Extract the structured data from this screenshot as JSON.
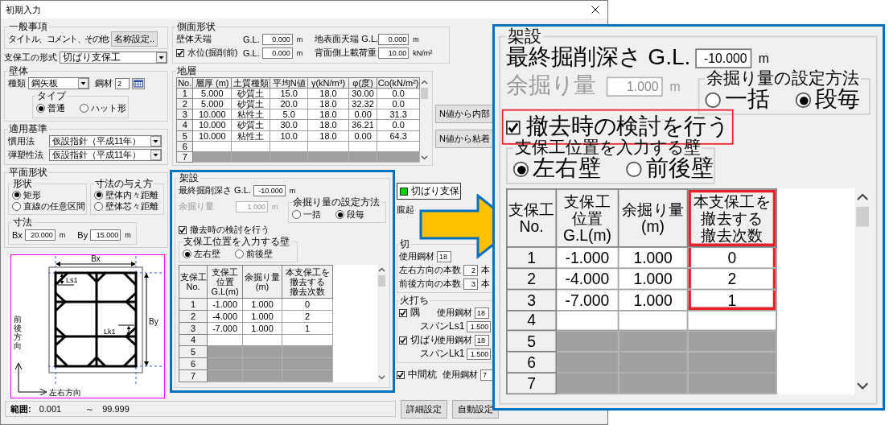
{
  "window": {
    "title": "初期入力"
  },
  "general": {
    "legend": "一般事項",
    "label": "タイトル、コメント、その他:",
    "button": "名称設定.."
  },
  "support_type": {
    "label": "支保工の形式",
    "value": "切ばり支保工"
  },
  "wall": {
    "legend": "壁体",
    "kind_label": "種類",
    "kind_value": "鋼矢板",
    "steel_label": "鋼材",
    "steel_value": "2",
    "type_legend": "タイプ",
    "types": [
      {
        "label": "普通",
        "selected": true
      },
      {
        "label": "ハット形",
        "selected": false
      }
    ]
  },
  "standards": {
    "legend": "適用基準",
    "rows": [
      {
        "label": "慣用法",
        "value": "仮設指針（平成11年）"
      },
      {
        "label": "弾塑性法",
        "value": "仮設指針（平成11年）"
      }
    ]
  },
  "plan_shape": {
    "legend": "平面形状",
    "shape_legend": "形状",
    "shapes": [
      {
        "label": "矩形",
        "selected": true
      },
      {
        "label": "直線の任意区間",
        "selected": false
      }
    ],
    "method_legend": "寸法の与え方",
    "methods": [
      {
        "label": "壁体内々距離",
        "selected": true
      },
      {
        "label": "壁体芯々距離",
        "selected": false
      }
    ],
    "dims_legend": "寸法",
    "bx_label": "Bx",
    "bx_value": "20.000",
    "bx_unit": "m",
    "by_label": "By",
    "by_value": "15.000",
    "by_unit": "m"
  },
  "plan_diagram": {
    "bx": "Bx",
    "by": "By",
    "ls1": "Ls1",
    "lk1": "Lk1",
    "front_back": "前後方向",
    "left_right": "左右方向"
  },
  "side_shape": {
    "legend": "側面形状",
    "wall_top": {
      "label": "壁体天端",
      "gl": "G.L.",
      "value": "0.000",
      "unit": "m"
    },
    "ground_top": {
      "label": "地表面天端 G.L.",
      "value": "0.000",
      "unit": "m"
    },
    "water": {
      "label": "水位(掘削前)",
      "checked": true,
      "gl": "G.L.",
      "value": "0.000",
      "unit": "m"
    },
    "surcharge": {
      "label": "背面側上載荷重",
      "value": "10.00",
      "unit": "kN/m²"
    }
  },
  "strata": {
    "legend": "地層",
    "columns": [
      "No.",
      "層厚 (m)",
      "土質種類",
      "平均N値",
      "γ(kN/m³)",
      "φ(度)",
      "Co(kN/m²)"
    ],
    "rows": [
      {
        "cells": [
          "1",
          "5.000",
          "砂質土",
          "15.0",
          "18.0",
          "30.00",
          "0.0"
        ],
        "disabled": false
      },
      {
        "cells": [
          "2",
          "5.000",
          "砂質土",
          "20.0",
          "18.0",
          "32.32",
          "0.0"
        ],
        "disabled": false
      },
      {
        "cells": [
          "3",
          "10.000",
          "粘性土",
          "5.0",
          "18.0",
          "0.00",
          "31.3"
        ],
        "disabled": false
      },
      {
        "cells": [
          "4",
          "10.000",
          "砂質土",
          "30.0",
          "18.0",
          "36.21",
          "0.0"
        ],
        "disabled": false
      },
      {
        "cells": [
          "5",
          "10.000",
          "粘性土",
          "10.0",
          "18.0",
          "0.00",
          "64.3"
        ],
        "disabled": false
      },
      {
        "cells": [
          "6"
        ],
        "disabled": false
      },
      {
        "cells": [
          "7"
        ],
        "disabled": true
      }
    ]
  },
  "strata_buttons": [
    "N値から内部",
    "N値から粘着"
  ],
  "construction": {
    "legend": "架設",
    "depth": {
      "label": "最終掘削深さ G.L.",
      "value": "-10.000",
      "unit": "m"
    },
    "overdig": {
      "label": "余掘り量",
      "value": "1.000",
      "unit": "m",
      "disabled": true
    },
    "method": {
      "legend": "余掘り量の設定方法",
      "options": [
        {
          "label": "一括",
          "selected": false
        },
        {
          "label": "段毎",
          "selected": true
        }
      ]
    },
    "removal_check": {
      "label": "撤去時の検討を行う",
      "checked": true,
      "highlighted": false
    },
    "wall_select": {
      "legend": "支保工位置を入力する壁",
      "options": [
        {
          "label": "左右壁",
          "selected": true
        },
        {
          "label": "前後壁",
          "selected": false
        }
      ]
    },
    "table": {
      "columns": [
        {
          "lines": [
            "支保工",
            "No."
          ],
          "highlighted": false
        },
        {
          "lines": [
            "支保工",
            "位置",
            "G.L(m)"
          ],
          "highlighted": false
        },
        {
          "lines": [
            "余掘り量",
            "(m)"
          ],
          "highlighted": false
        },
        {
          "lines": [
            "本支保工を",
            "撤去する",
            "撤去次数"
          ],
          "highlighted": false
        }
      ],
      "rows": [
        {
          "cells": [
            "1",
            "-1.000",
            "1.000",
            "0"
          ],
          "disabled": false
        },
        {
          "cells": [
            "2",
            "-4.000",
            "1.000",
            "2"
          ],
          "disabled": false
        },
        {
          "cells": [
            "3",
            "-7.000",
            "1.000",
            "1"
          ],
          "disabled": false
        },
        {
          "cells": [
            "4"
          ],
          "disabled": false
        },
        {
          "cells": [
            "5"
          ],
          "disabled": true
        },
        {
          "cells": [
            "6"
          ],
          "disabled": true
        },
        {
          "cells": [
            "7"
          ],
          "disabled": true
        }
      ]
    }
  },
  "support_system": {
    "button": "切ばり支保",
    "waler_label": "腹起",
    "strut_legend": "切",
    "steel_label": "使用鋼材",
    "steel_value": "18",
    "counts": [
      {
        "label": "左右方向の本数",
        "value": "2",
        "unit": "本"
      },
      {
        "label": "前後方向の本数",
        "value": "3",
        "unit": "本"
      }
    ]
  },
  "hiuchi": {
    "legend": "火打ち",
    "items": [
      {
        "label": "隅",
        "checked": true,
        "steel_label": "使用鋼材",
        "steel_value": "18",
        "span_label": "スパンLs1",
        "span_value": "1.500"
      },
      {
        "label": "切ばり",
        "checked": true,
        "steel_label": "使用鋼材",
        "steel_value": "18",
        "span_label": "スパンLk1",
        "span_value": "1.500"
      }
    ]
  },
  "middle_pile": {
    "label": "中間杭",
    "checked": true,
    "steel_label": "使用鋼材",
    "steel_value": "7"
  },
  "status": {
    "range_label": "範囲:",
    "min": "0.001",
    "tilde": "～",
    "max": "99.999"
  },
  "buttons": [
    "詳細設定",
    "自動設定"
  ],
  "callout": {
    "legend": "架設",
    "depth": {
      "label": "最終掘削深さ G.L.",
      "value": "-10.000",
      "unit": "m"
    },
    "overdig": {
      "label": "余掘り量",
      "value": "1.000",
      "unit": "m",
      "disabled": true
    },
    "method": {
      "legend": "余掘り量の設定方法",
      "options": [
        {
          "label": "一括",
          "selected": false
        },
        {
          "label": "段毎",
          "selected": true
        }
      ]
    },
    "removal_check": {
      "label": "撤去時の検討を行う",
      "checked": true,
      "highlighted": true
    },
    "wall_select": {
      "legend": "支保工位置を入力する壁",
      "options": [
        {
          "label": "左右壁",
          "selected": true
        },
        {
          "label": "前後壁",
          "selected": false
        }
      ]
    },
    "table": {
      "columns": [
        {
          "lines": [
            "支保工",
            "No."
          ],
          "highlighted": false
        },
        {
          "lines": [
            "支保工",
            "位置",
            "G.L(m)"
          ],
          "highlighted": false
        },
        {
          "lines": [
            "余掘り量",
            "(m)"
          ],
          "highlighted": false
        },
        {
          "lines": [
            "本支保工を",
            "撤去する",
            "撤去次数"
          ],
          "highlighted": true
        }
      ],
      "rows": [
        {
          "cells": [
            "1",
            "-1.000",
            "1.000",
            "0"
          ],
          "disabled": false
        },
        {
          "cells": [
            "2",
            "-4.000",
            "1.000",
            "2"
          ],
          "disabled": false
        },
        {
          "cells": [
            "3",
            "-7.000",
            "1.000",
            "1"
          ],
          "disabled": false
        },
        {
          "cells": [
            "4"
          ],
          "disabled": false
        },
        {
          "cells": [
            "5"
          ],
          "disabled": true
        },
        {
          "cells": [
            "6"
          ],
          "disabled": true
        },
        {
          "cells": [
            "7"
          ],
          "disabled": true
        }
      ]
    }
  }
}
